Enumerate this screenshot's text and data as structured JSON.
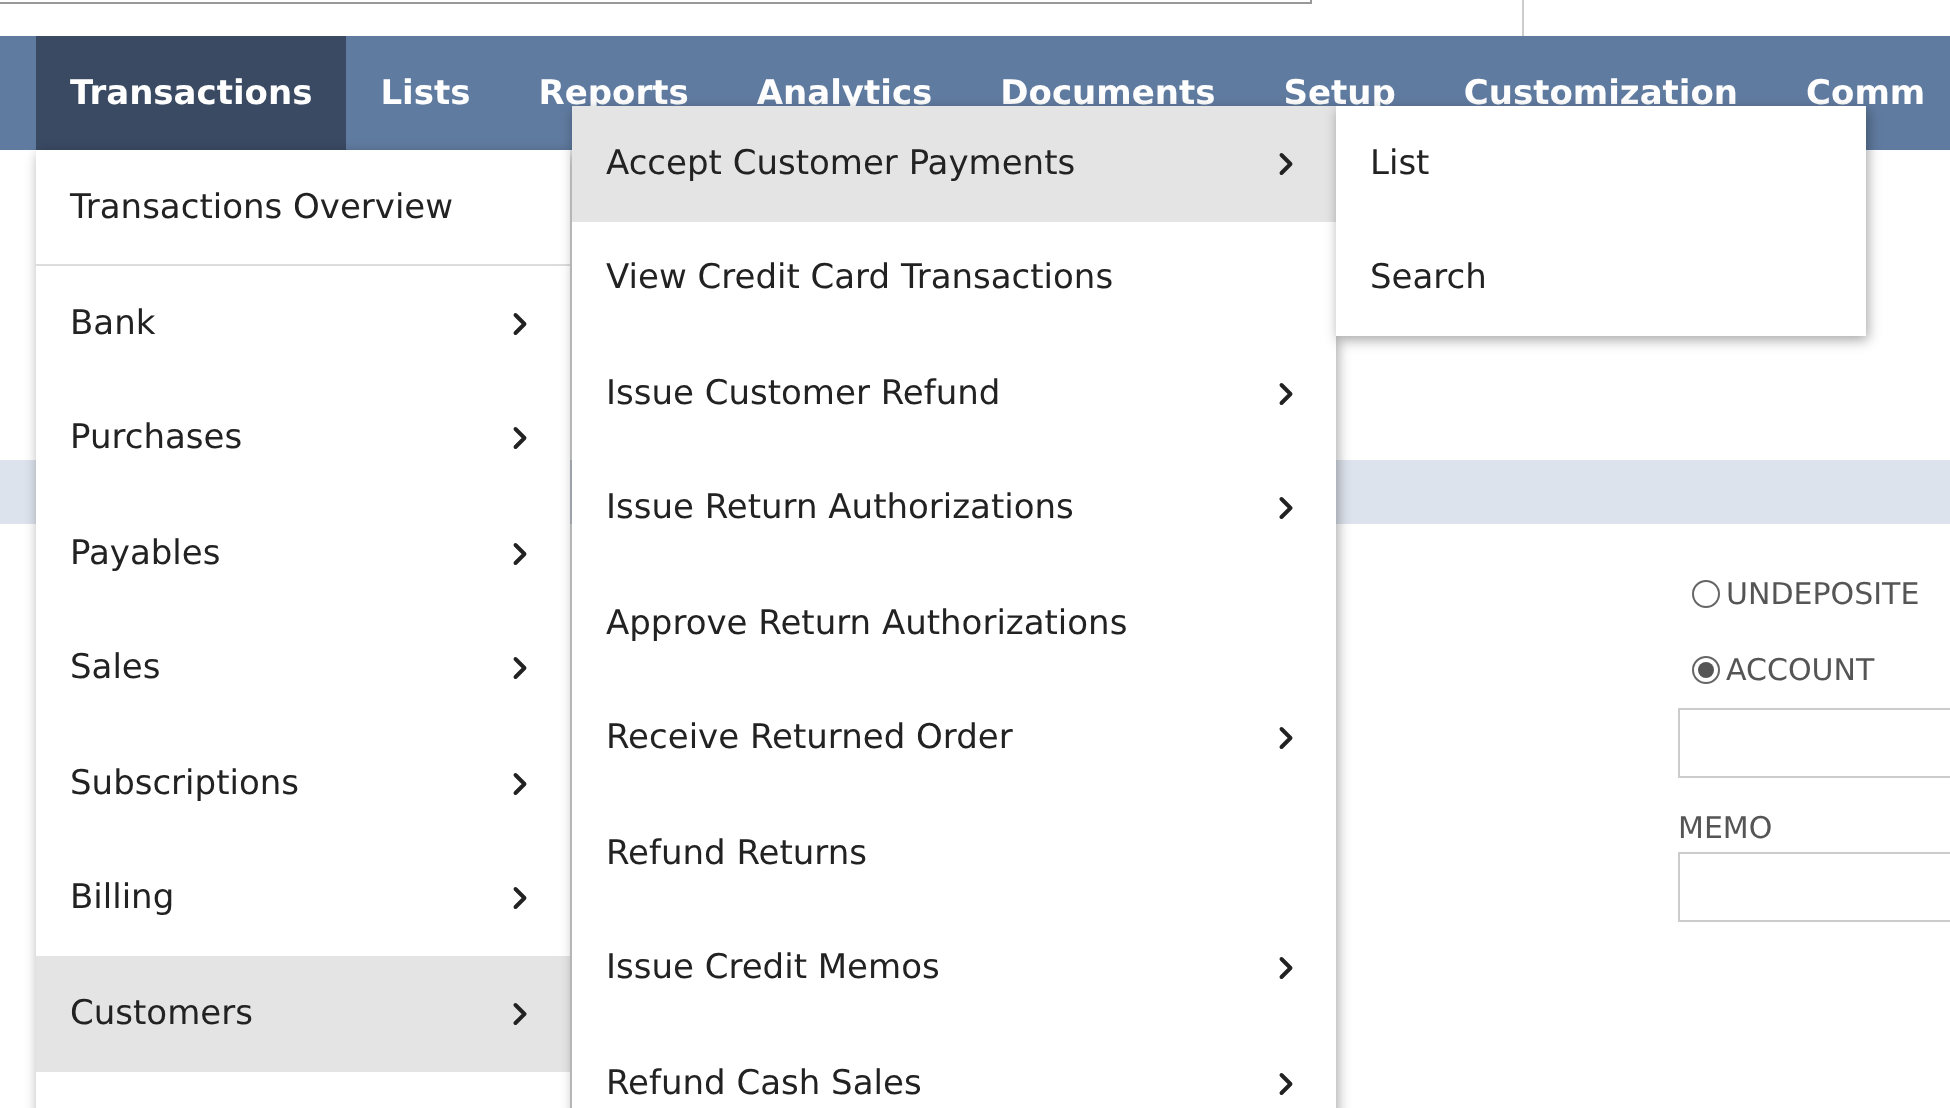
{
  "nav": [
    {
      "label": "Transactions",
      "selected": true
    },
    {
      "label": "Lists",
      "selected": false
    },
    {
      "label": "Reports",
      "selected": false
    },
    {
      "label": "Analytics",
      "selected": false
    },
    {
      "label": "Documents",
      "selected": false
    },
    {
      "label": "Setup",
      "selected": false
    },
    {
      "label": "Customization",
      "selected": false
    },
    {
      "label": "Comm",
      "selected": false
    }
  ],
  "transactions_menu": {
    "overview": "Transactions Overview",
    "items": [
      {
        "label": "Bank",
        "has_submenu": true,
        "selected": false
      },
      {
        "label": "Purchases",
        "has_submenu": true,
        "selected": false
      },
      {
        "label": "Payables",
        "has_submenu": true,
        "selected": false
      },
      {
        "label": "Sales",
        "has_submenu": true,
        "selected": false
      },
      {
        "label": "Subscriptions",
        "has_submenu": true,
        "selected": false
      },
      {
        "label": "Billing",
        "has_submenu": true,
        "selected": false
      },
      {
        "label": "Customers",
        "has_submenu": true,
        "selected": true
      }
    ]
  },
  "customers_menu": {
    "items": [
      {
        "label": "Accept Customer Payments",
        "has_submenu": true,
        "selected": true
      },
      {
        "label": "View Credit Card Transactions",
        "has_submenu": false,
        "selected": false
      },
      {
        "label": "Issue Customer Refund",
        "has_submenu": true,
        "selected": false
      },
      {
        "label": "Issue Return Authorizations",
        "has_submenu": true,
        "selected": false
      },
      {
        "label": "Approve Return Authorizations",
        "has_submenu": false,
        "selected": false
      },
      {
        "label": "Receive Returned Order",
        "has_submenu": true,
        "selected": false
      },
      {
        "label": "Refund Returns",
        "has_submenu": false,
        "selected": false
      },
      {
        "label": "Issue Credit Memos",
        "has_submenu": true,
        "selected": false
      },
      {
        "label": "Refund Cash Sales",
        "has_submenu": true,
        "selected": false
      }
    ]
  },
  "payments_menu": {
    "items": [
      {
        "label": "List",
        "selected": false
      },
      {
        "label": "Search",
        "selected": false
      }
    ]
  },
  "form": {
    "radios": [
      {
        "label": "UNDEPOSITE",
        "selected": false
      },
      {
        "label": "ACCOUNT",
        "selected": true
      }
    ],
    "memo_label": "MEMO"
  }
}
